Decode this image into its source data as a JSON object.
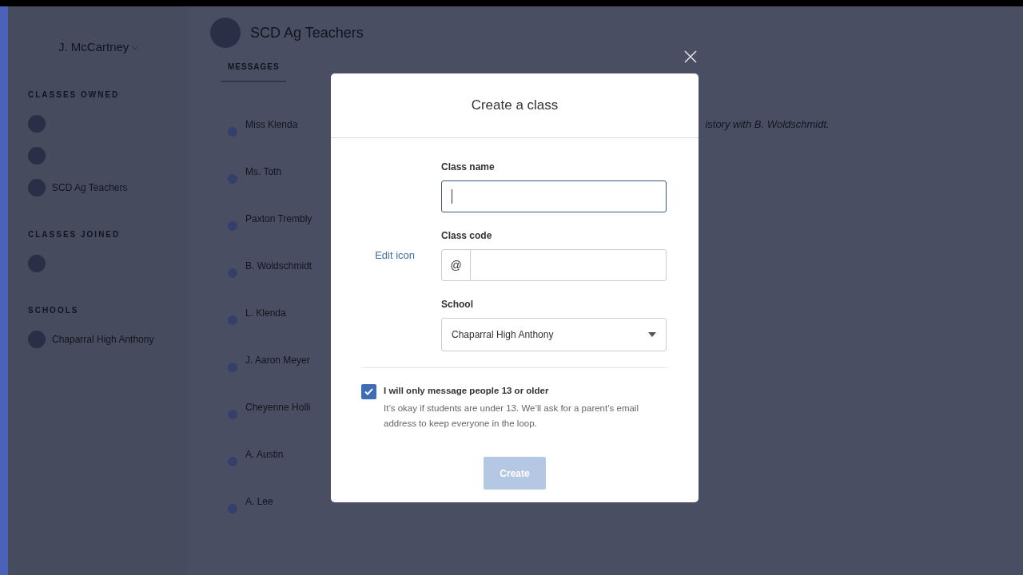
{
  "sidebar": {
    "user_name": "J. McCartney",
    "sections": [
      {
        "heading": "CLASSES OWNED",
        "items": [
          {
            "kind": "avatar"
          },
          {
            "kind": "avatar"
          },
          {
            "kind": "labeled",
            "label": "SCD Ag Teachers"
          }
        ]
      },
      {
        "heading": "CLASSES JOINED",
        "items": [
          {
            "kind": "avatar"
          }
        ]
      },
      {
        "heading": "SCHOOLS",
        "items": [
          {
            "kind": "labeled",
            "label": "Chaparral High Anthony"
          }
        ]
      }
    ]
  },
  "header": {
    "title": "SCD Ag Teachers",
    "tabs": [
      {
        "label": "MESSAGES",
        "selected": true
      }
    ]
  },
  "messages": [
    {
      "name": "Miss Klenda"
    },
    {
      "name": "Ms. Toth"
    },
    {
      "name": "Paxton Trembly"
    },
    {
      "name": "B. Woldschmidt"
    },
    {
      "name": "L. Klenda"
    },
    {
      "name": "J. Aaron Meyer"
    },
    {
      "name": "Cheyenne Holli"
    },
    {
      "name": "A. Austin"
    },
    {
      "name": "A. Lee"
    }
  ],
  "conversation": {
    "heading": "istory with B. Woldschmidt."
  },
  "dialog": {
    "title": "Create a class",
    "edit_icon_link": "Edit icon",
    "fields": [
      {
        "kind": "text",
        "label": "Class name",
        "focused": true
      },
      {
        "kind": "prefixed",
        "label": "Class code",
        "prefix": "@"
      },
      {
        "kind": "select",
        "label": "School",
        "value": "Chaparral High Anthony"
      }
    ],
    "consent": {
      "checked": true,
      "label": "I will only message people 13 or older",
      "note": "It’s okay if students are under 13. We’ll ask for a parent’s email address to keep everyone in the loop."
    },
    "submit": {
      "label": "Create",
      "disabled": true
    }
  }
}
